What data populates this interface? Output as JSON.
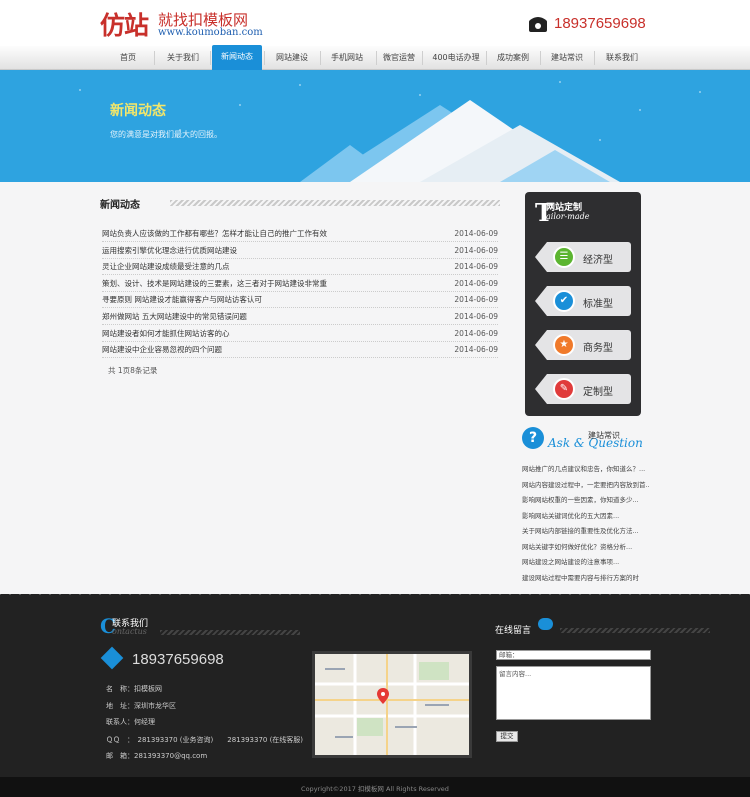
{
  "header": {
    "logo_cn": "仿站",
    "logo_sub": "就找扣模板网",
    "logo_url": "www.koumoban.com",
    "phone": "18937659698"
  },
  "nav": {
    "items": [
      "首页",
      "关于我们",
      "新闻动态",
      "网站建设",
      "手机网站",
      "微官运营",
      "400电话办理",
      "成功案例",
      "建站常识",
      "联系我们"
    ],
    "active_index": 2
  },
  "banner": {
    "title": "新闻动态",
    "subtitle": "您的满意是对我们最大的回报。"
  },
  "news": {
    "heading": "新闻动态",
    "rows": [
      {
        "title": "网站负责人应该做的工作都有哪些？怎样才能让自己的推广工作有效",
        "date": "2014-06-09"
      },
      {
        "title": "运用搜索引擎优化理念进行优质网站建设",
        "date": "2014-06-09"
      },
      {
        "title": "灵让企业网站建设成绩最受注意的几点",
        "date": "2014-06-09"
      },
      {
        "title": "策划、设计、技术是网站建设的三要素，这三者对于网站建设非常重",
        "date": "2014-06-09"
      },
      {
        "title": "寻要原则 网站建设才能赢得客户与网站访客认可",
        "date": "2014-06-09"
      },
      {
        "title": "郑州做网站 五大网站建设中的常见错误问题",
        "date": "2014-06-09"
      },
      {
        "title": "网站建设者如何才能抓住网站访客的心",
        "date": "2014-06-09"
      },
      {
        "title": "网站建设中企业容易忽视的四个问题",
        "date": "2014-06-09"
      }
    ],
    "pager": "共 1页8条记录"
  },
  "sidebar": {
    "custom_letter": "T",
    "custom_title": "网站定制",
    "custom_subtitle": "ailor-made",
    "tags": [
      {
        "label": "经济型",
        "color": "#5cb531",
        "icon": "list-icon",
        "glyph": "☰"
      },
      {
        "label": "标准型",
        "color": "#1a8fd8",
        "icon": "check-icon",
        "glyph": "✔"
      },
      {
        "label": "商务型",
        "color": "#f07a2b",
        "icon": "star-icon",
        "glyph": "★"
      },
      {
        "label": "定制型",
        "color": "#e03b3b",
        "icon": "pen-icon",
        "glyph": "✎"
      }
    ],
    "qa_title": "建站常识",
    "qa_word": "Ask & Question",
    "qa_mark": "?",
    "links": [
      "网站推广的几点建议和忠告，你知道么？...",
      "网站内容建设过程中，一定要把内容放到首...",
      "影响网站权重的一些因素，你知道多少...",
      "影响网站关键词优化的五大因素...",
      "关于网站内部链接的重要性及优化方法...",
      "网站关键字如何做好优化？资格分析...",
      "网站建设之网站建设的注意事项...",
      "建设网站过程中需要内容与排行方案的时"
    ]
  },
  "footer": {
    "contact_letter": "C",
    "contact_title": "联系我们",
    "contact_en": "ontactus",
    "phone": "18937659698",
    "lines": [
      "名　称：扣模板网",
      "地　址：深圳市龙华区",
      "联系人：何经理",
      "ＱＱ　：　281393370 (业务咨询)　　281393370 (在线客服)",
      "邮　箱：281393370@qq.com"
    ],
    "message_title": "在线留言",
    "email_placeholder": "邮箱：",
    "content_placeholder": "留言内容...",
    "submit": "提交",
    "copyright": "Copyright©2017 扣模板网 All Rights Reserved"
  }
}
